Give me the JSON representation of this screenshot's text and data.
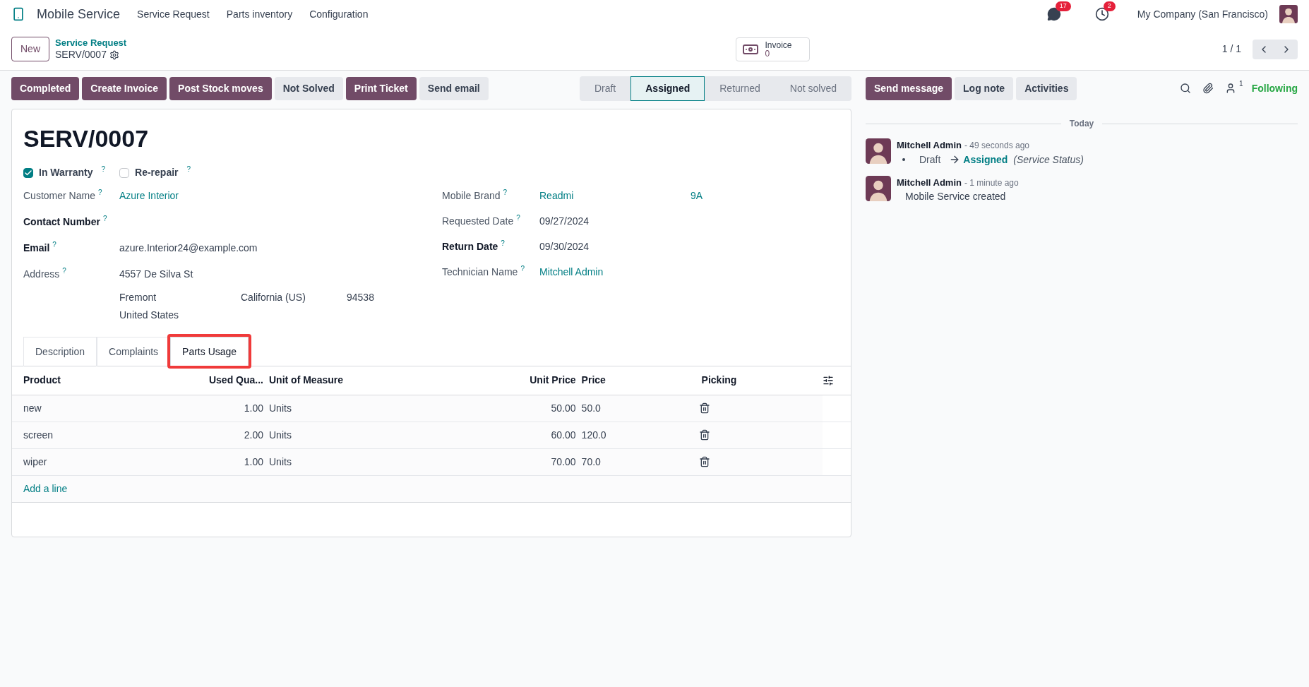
{
  "navbar": {
    "app_name": "Mobile Service",
    "menu": [
      "Service Request",
      "Parts inventory",
      "Configuration"
    ],
    "messages_badge": "17",
    "activities_badge": "2",
    "company": "My Company (San Francisco)"
  },
  "control_panel": {
    "new_button": "New",
    "breadcrumb": "Service Request",
    "record": "SERV/0007",
    "smart_button": {
      "label": "Invoice",
      "value": "0"
    },
    "pager": "1 / 1"
  },
  "actions": [
    {
      "label": "Completed",
      "kind": "primary"
    },
    {
      "label": "Create Invoice",
      "kind": "primary"
    },
    {
      "label": "Post Stock moves",
      "kind": "primary"
    },
    {
      "label": "Not Solved",
      "kind": "secondary"
    },
    {
      "label": "Print Ticket",
      "kind": "primary"
    },
    {
      "label": "Send email",
      "kind": "secondary"
    }
  ],
  "statusbar": [
    {
      "label": "Draft",
      "selected": false
    },
    {
      "label": "Assigned",
      "selected": true
    },
    {
      "label": "Returned",
      "selected": false
    },
    {
      "label": "Not solved",
      "selected": false
    }
  ],
  "chatter_buttons": [
    {
      "label": "Send message",
      "kind": "primary"
    },
    {
      "label": "Log note",
      "kind": "secondary"
    },
    {
      "label": "Activities",
      "kind": "secondary"
    }
  ],
  "followers_count": "1",
  "following": "Following",
  "form": {
    "title": "SERV/0007",
    "checkboxes": [
      {
        "label": "In Warranty",
        "help": "?",
        "checked": true
      },
      {
        "label": "Re-repair",
        "help": "?",
        "checked": false
      }
    ],
    "left_fields": [
      {
        "label": "Customer Name",
        "help": "?",
        "value": "Azure Interior",
        "kind": "link",
        "bold": false
      },
      {
        "label": "Contact Number",
        "help": "?",
        "bold": true
      },
      {
        "label": "Email",
        "help": "?",
        "value": "azure.Interior24@example.com",
        "kind": "text",
        "bold": true
      }
    ],
    "address": {
      "label": "Address",
      "help": "?",
      "street": "4557 De Silva St",
      "city": "Fremont",
      "state": "California (US)",
      "zip": "94538",
      "country": "United States"
    },
    "right_fields": [
      {
        "label": "Mobile Brand",
        "help": "?",
        "value": "Readmi",
        "extra": "9A",
        "kind": "link",
        "bold": false
      },
      {
        "label": "Requested Date",
        "help": "?",
        "value": "09/27/2024",
        "kind": "text",
        "bold": false
      },
      {
        "label": "Return Date",
        "help": "?",
        "value": "09/30/2024",
        "kind": "text",
        "bold": true
      },
      {
        "label": "Technician Name",
        "help": "?",
        "value": "Mitchell Admin",
        "kind": "link",
        "bold": false
      }
    ],
    "tabs": [
      {
        "label": "Description",
        "selected": false,
        "highlighted": false
      },
      {
        "label": "Complaints",
        "selected": false,
        "highlighted": false
      },
      {
        "label": "Parts Usage",
        "selected": true,
        "highlighted": true
      }
    ],
    "table": {
      "columns": [
        "Product",
        "Used Qua...",
        "Unit of Measure",
        "Unit Price",
        "Price",
        "Picking"
      ],
      "rows": [
        [
          "new",
          "1.00",
          "Units",
          "50.00",
          "50.0"
        ],
        [
          "screen",
          "2.00",
          "Units",
          "60.00",
          "120.0"
        ],
        [
          "wiper",
          "1.00",
          "Units",
          "70.00",
          "70.0"
        ]
      ],
      "add_line": "Add a line"
    }
  },
  "chatter": {
    "date": "Today",
    "messages": [
      {
        "author": "Mitchell Admin",
        "time": "- 49 seconds ago",
        "kind": "tracking",
        "old": "Draft",
        "new": "Assigned",
        "field": "(Service Status)"
      },
      {
        "author": "Mitchell Admin",
        "time": "- 1 minute ago",
        "kind": "note",
        "body": "Mobile Service created"
      }
    ]
  }
}
